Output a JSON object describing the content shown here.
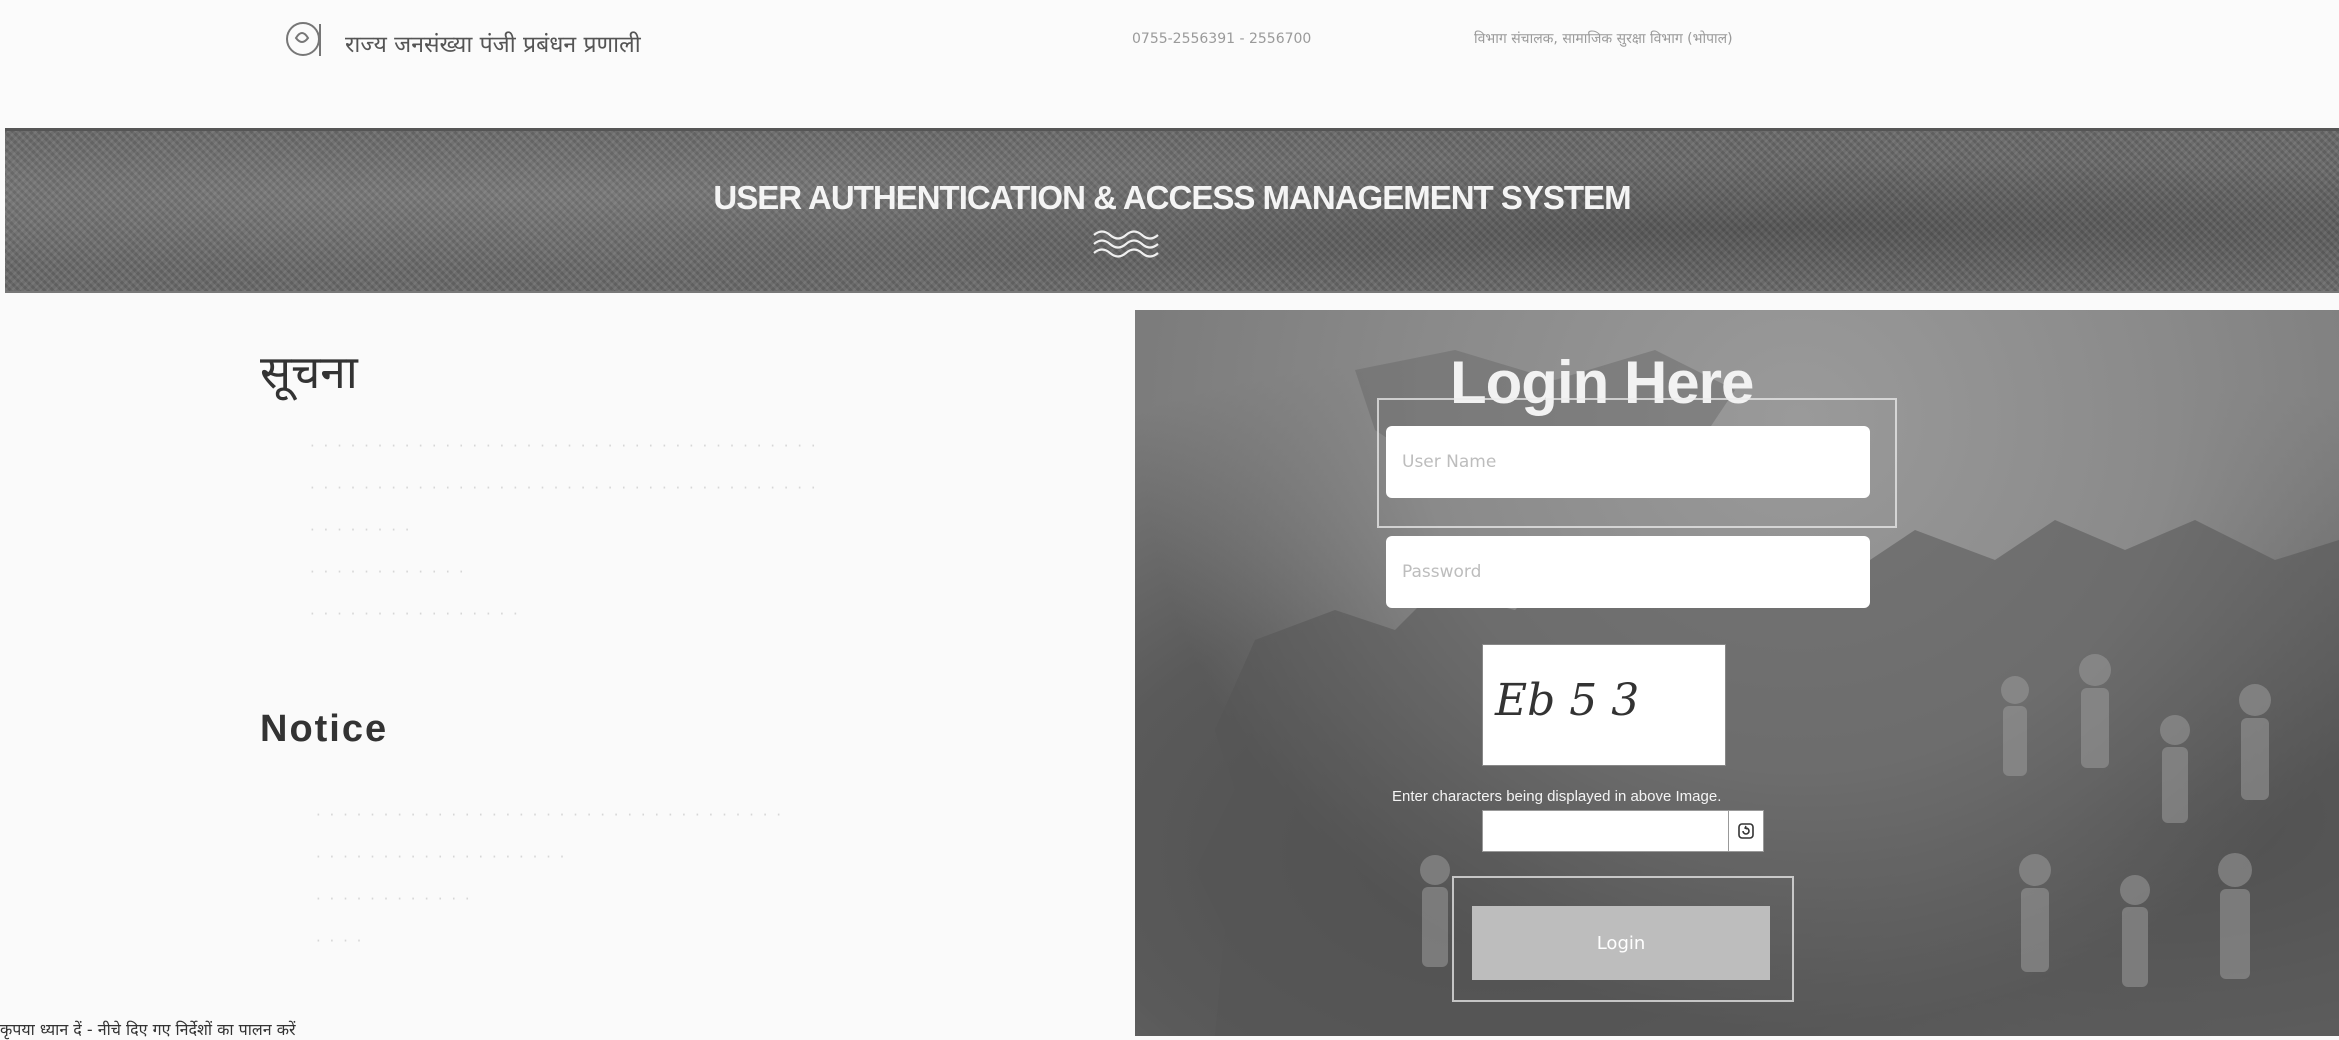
{
  "header": {
    "site_title": "राज्य जनसंख्या पंजी प्रबंधन प्रणाली",
    "contact": "0755-2556391 - 2556700",
    "office": "विभाग संचालक, सामाजिक सुरक्षा विभाग (भोपाल)"
  },
  "banner": {
    "title": "USER AUTHENTICATION & ACCESS MANAGEMENT SYSTEM"
  },
  "notices": {
    "hindi_heading": "सूचना",
    "english_heading": "Notice"
  },
  "login": {
    "title": "Login Here",
    "username_placeholder": "User Name",
    "password_placeholder": "Password",
    "captcha_text": "Eb 5 3",
    "captcha_caption": "Enter characters being displayed in above Image.",
    "button_label": "Login"
  },
  "footer": {
    "bottom_text": "कृपया ध्यान दें - नीचे दिए गए निर्देशों का पालन करें"
  },
  "icons": {
    "logo": "state-emblem-icon",
    "wave": "wave-divider-icon",
    "refresh": "refresh-icon"
  }
}
